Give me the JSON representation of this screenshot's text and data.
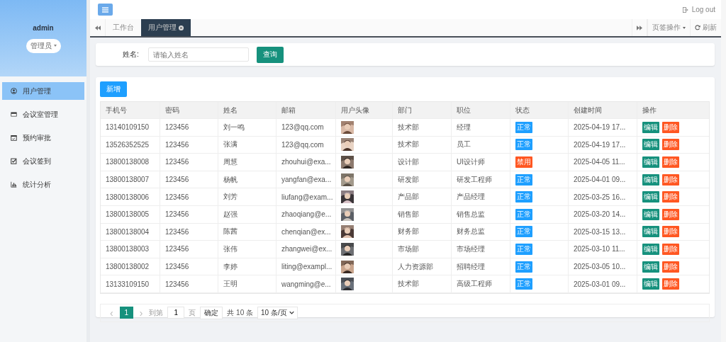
{
  "sidebar": {
    "user": "admin",
    "role": "管理员",
    "items": [
      {
        "label": "用户管理",
        "selected": true
      },
      {
        "label": "会议室管理",
        "selected": false
      },
      {
        "label": "预约审批",
        "selected": false
      },
      {
        "label": "会议签到",
        "selected": false
      },
      {
        "label": "统计分析",
        "selected": false
      }
    ]
  },
  "header": {
    "logout": "Log out"
  },
  "tabs": {
    "items": [
      {
        "label": "工作台",
        "selected": false,
        "closable": false
      },
      {
        "label": "用户管理",
        "selected": true,
        "closable": true
      }
    ],
    "actions": "页签操作",
    "refresh": "刷新"
  },
  "search": {
    "label": "姓名:",
    "placeholder": "请输入姓名",
    "button": "查询"
  },
  "add_button": "新增",
  "table": {
    "columns": [
      "手机号",
      "密码",
      "姓名",
      "邮箱",
      "用户头像",
      "部门",
      "职位",
      "状态",
      "创建时间",
      "操作"
    ],
    "rows": [
      {
        "phone": "13140109150",
        "password": "123456",
        "name": "刘一鸣",
        "email": "123@qq.com",
        "dept": "技术部",
        "position": "经理",
        "status": {
          "text": "正常",
          "kind": "normal"
        },
        "created": "2025-04-19 17...",
        "actions": [
          "编辑",
          "删除"
        ]
      },
      {
        "phone": "13526352525",
        "password": "123456",
        "name": "张满",
        "email": "123@qq.com",
        "dept": "技术部",
        "position": "员工",
        "status": {
          "text": "正常",
          "kind": "normal"
        },
        "created": "2025-04-19 17...",
        "actions": [
          "编辑",
          "删除"
        ]
      },
      {
        "phone": "13800138008",
        "password": "123456",
        "name": "周慧",
        "email": "zhouhui@exa...",
        "dept": "设计部",
        "position": "UI设计师",
        "status": {
          "text": "禁用",
          "kind": "disabled"
        },
        "created": "2025-04-05 11...",
        "actions": [
          "编辑",
          "删除"
        ]
      },
      {
        "phone": "13800138007",
        "password": "123456",
        "name": "杨帆",
        "email": "yangfan@exa...",
        "dept": "研发部",
        "position": "研发工程师",
        "status": {
          "text": "正常",
          "kind": "normal"
        },
        "created": "2025-04-01 09...",
        "actions": [
          "编辑",
          "删除"
        ]
      },
      {
        "phone": "13800138006",
        "password": "123456",
        "name": "刘芳",
        "email": "liufang@exam...",
        "dept": "产品部",
        "position": "产品经理",
        "status": {
          "text": "正常",
          "kind": "normal"
        },
        "created": "2025-03-25 16...",
        "actions": [
          "编辑",
          "删除"
        ]
      },
      {
        "phone": "13800138005",
        "password": "123456",
        "name": "赵强",
        "email": "zhaoqiang@e...",
        "dept": "销售部",
        "position": "销售总监",
        "status": {
          "text": "正常",
          "kind": "normal"
        },
        "created": "2025-03-20 14...",
        "actions": [
          "编辑",
          "删除"
        ]
      },
      {
        "phone": "13800138004",
        "password": "123456",
        "name": "陈茜",
        "email": "chenqian@ex...",
        "dept": "财务部",
        "position": "财务总监",
        "status": {
          "text": "正常",
          "kind": "normal"
        },
        "created": "2025-03-15 13...",
        "actions": [
          "编辑",
          "删除"
        ]
      },
      {
        "phone": "13800138003",
        "password": "123456",
        "name": "张伟",
        "email": "zhangwei@ex...",
        "dept": "市场部",
        "position": "市场经理",
        "status": {
          "text": "正常",
          "kind": "normal"
        },
        "created": "2025-03-10 11...",
        "actions": [
          "编辑",
          "删除"
        ]
      },
      {
        "phone": "13800138002",
        "password": "123456",
        "name": "李婷",
        "email": "liting@exampl...",
        "dept": "人力资源部",
        "position": "招聘经理",
        "status": {
          "text": "正常",
          "kind": "normal"
        },
        "created": "2025-03-05 10...",
        "actions": [
          "编辑",
          "删除"
        ]
      },
      {
        "phone": "13133109150",
        "password": "123456",
        "name": "王明",
        "email": "wangming@e...",
        "dept": "技术部",
        "position": "高级工程师",
        "status": {
          "text": "正常",
          "kind": "normal"
        },
        "created": "2025-03-01 09...",
        "actions": [
          "编辑",
          "删除"
        ]
      }
    ]
  },
  "pagination": {
    "prev": "‹",
    "next": "›",
    "pages": [
      {
        "label": "1",
        "selected": true
      }
    ],
    "goto": "到第",
    "page_value": "1",
    "page_unit": "页",
    "confirm": "确定",
    "total": "共 10 条",
    "page_size": "10 条/页"
  }
}
